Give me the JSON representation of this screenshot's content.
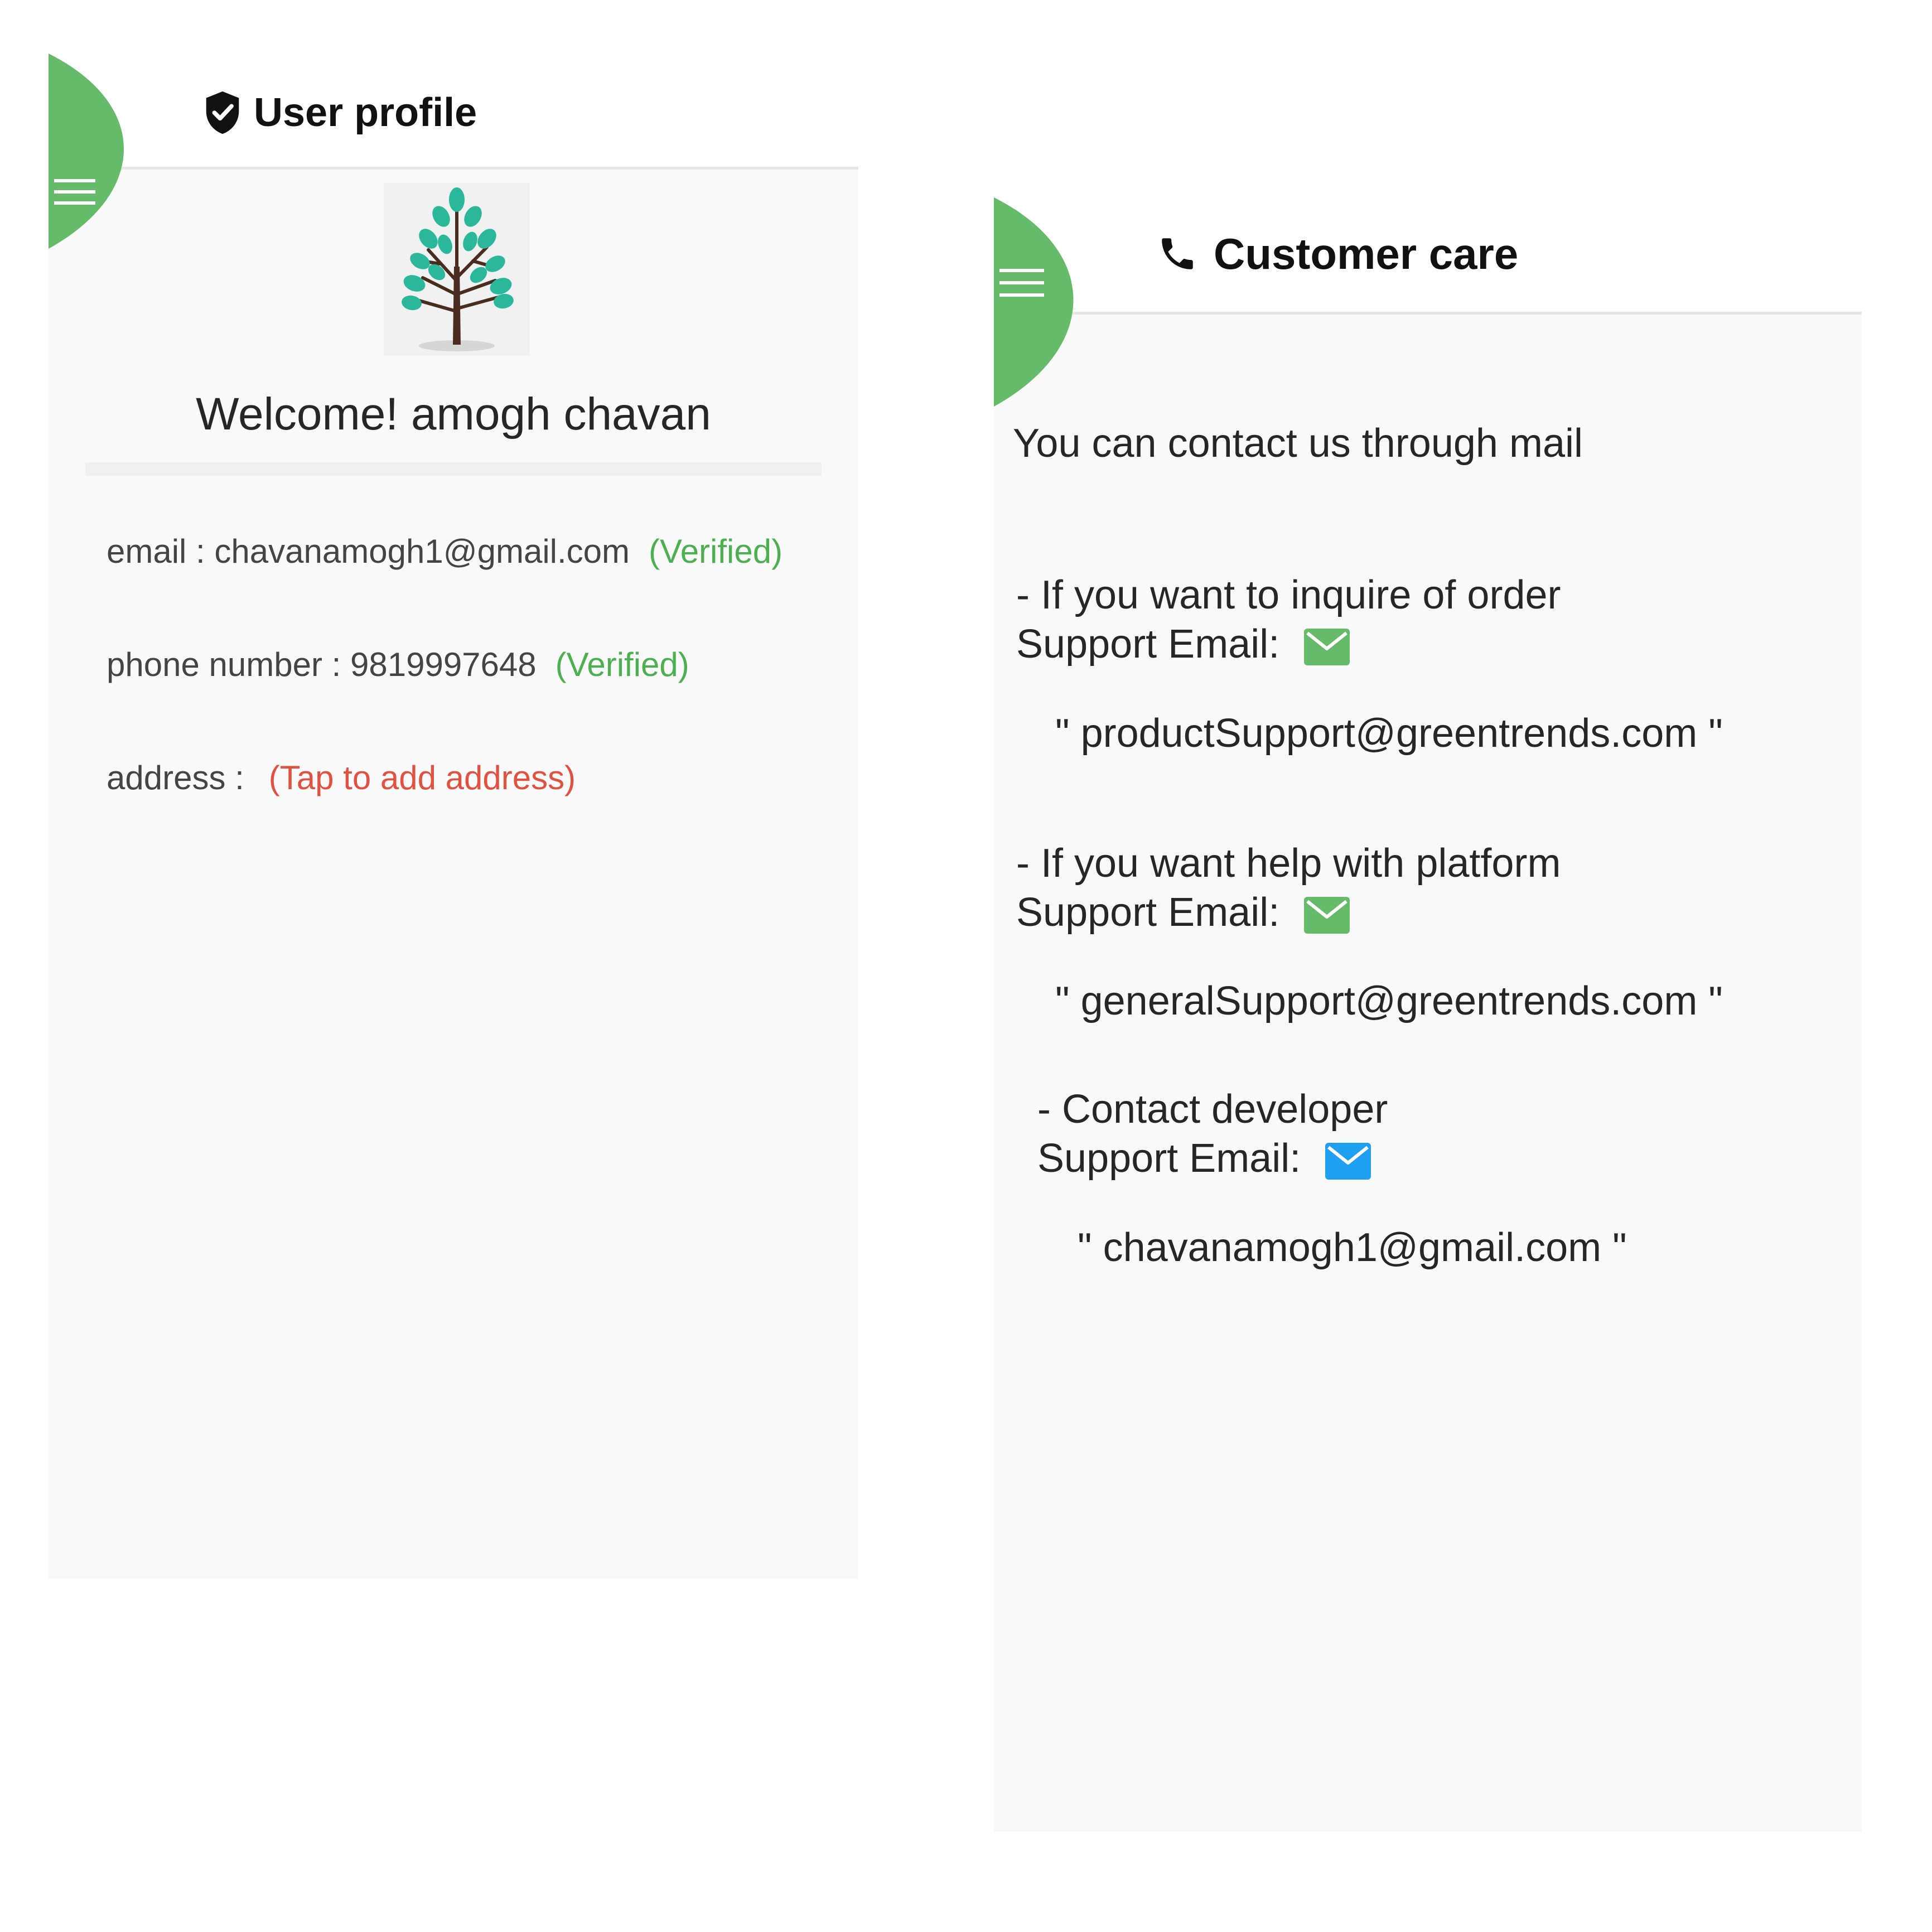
{
  "profile": {
    "title": "User profile",
    "welcome": "Welcome!  amogh chavan",
    "email_label": "email : ",
    "email_value": "chavanamogh1@gmail.com",
    "email_status": "(Verified)",
    "phone_label": "phone number : ",
    "phone_value": "9819997648",
    "phone_status": "(Verified)",
    "address_label": "address :",
    "address_action": "(Tap to add address)"
  },
  "care": {
    "title": "Customer care",
    "intro": "You can contact us through mail",
    "sections": [
      {
        "heading": "- If you want to inquire of order",
        "label": "Support Email:",
        "email": "\" productSupport@greentrends.com \""
      },
      {
        "heading": "- If you want help with platform",
        "label": "Support Email:",
        "email": "\" generalSupport@greentrends.com \""
      },
      {
        "heading": "- Contact developer",
        "label": "Support Email:",
        "email": "\" chavanamogh1@gmail.com \""
      }
    ]
  },
  "colors": {
    "leaf_green": "#66bb6a",
    "verified_green": "#4caf50",
    "tap_red": "#e0523f",
    "mail_green": "#66bb6a",
    "mail_blue": "#1e9ff2"
  },
  "icons": [
    "menu-icon",
    "shield-check-icon",
    "tree-icon",
    "phone-icon",
    "mail-icon"
  ]
}
